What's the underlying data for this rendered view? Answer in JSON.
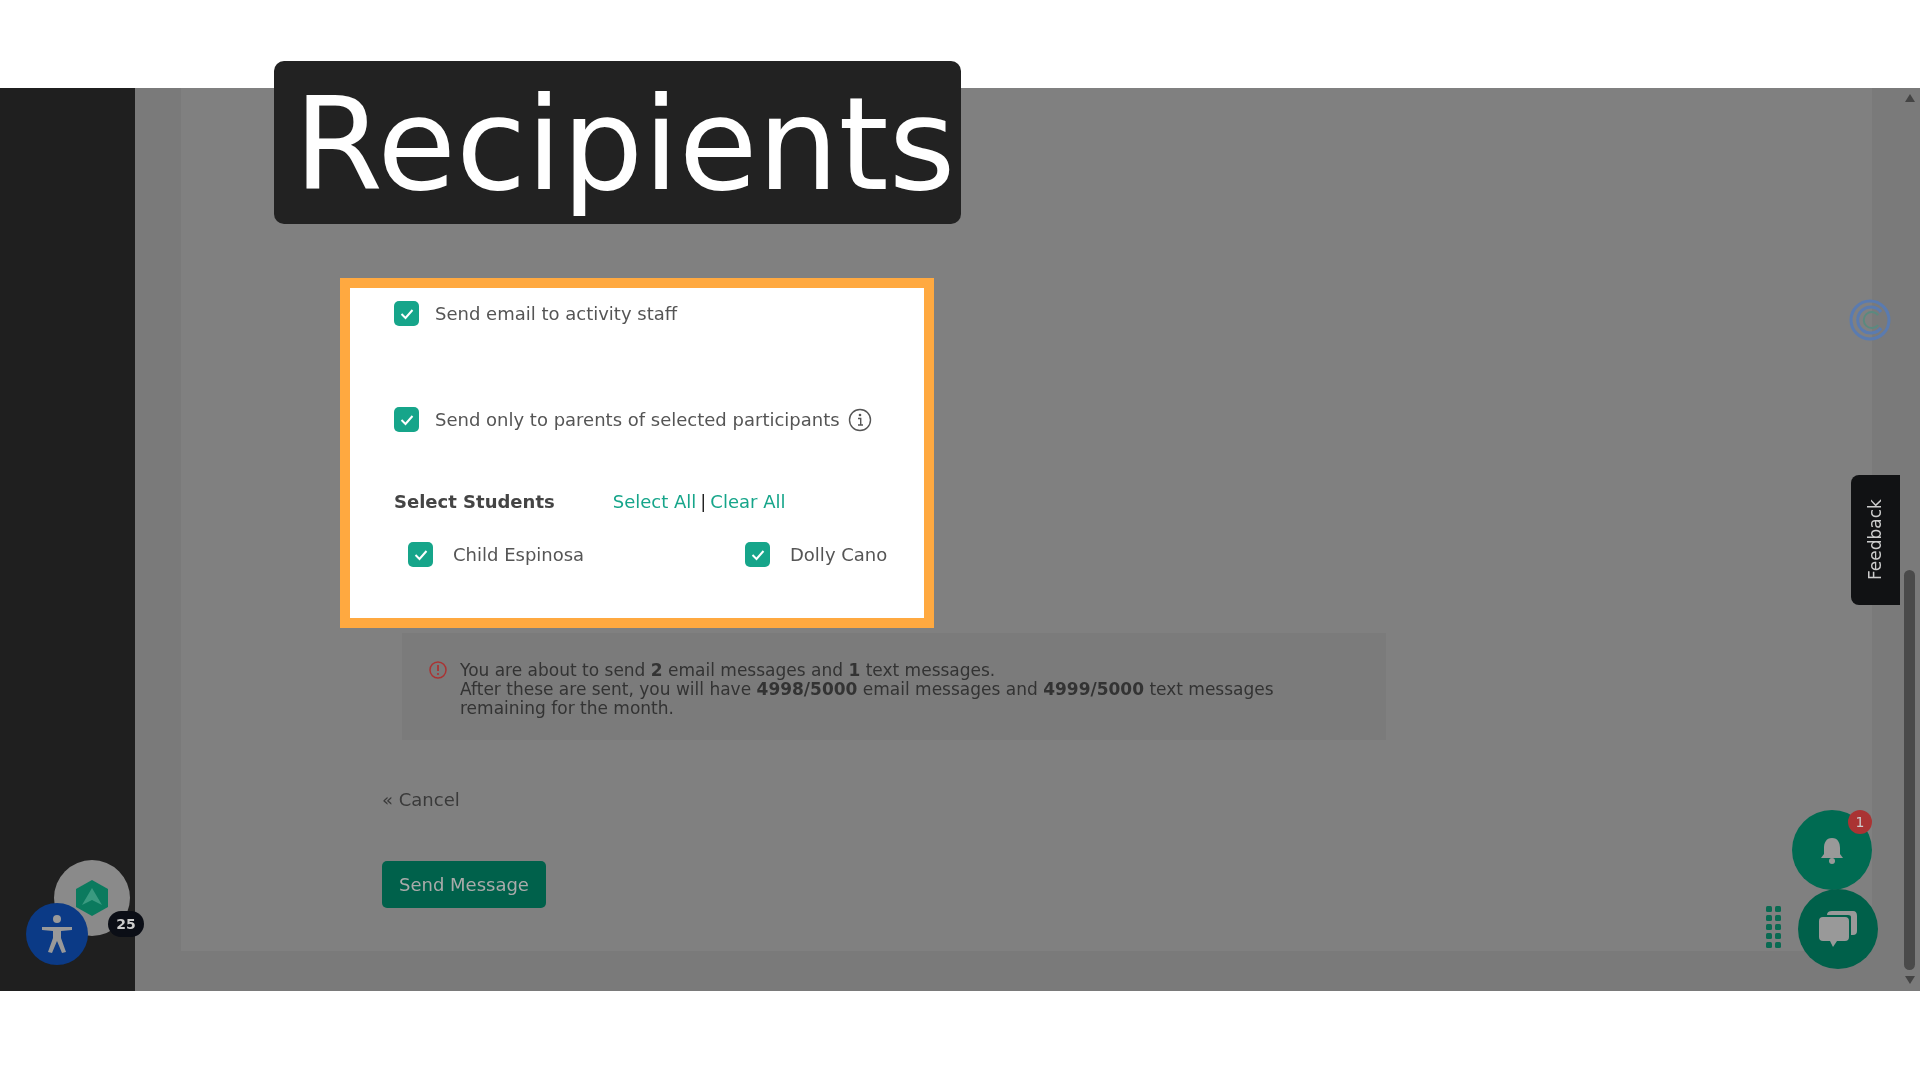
{
  "title_overlay": {
    "text": "Recipients"
  },
  "options": [
    {
      "label": "Send email to activity staff",
      "checked": true,
      "info": false
    },
    {
      "label": "Send only to parents of selected participants",
      "checked": true,
      "info": true
    }
  ],
  "students": {
    "heading": "Select Students",
    "select_all": "Select All",
    "separator": "|",
    "clear_all": "Clear All",
    "items": [
      {
        "name": "Child Espinosa",
        "checked": true
      },
      {
        "name": "Dolly Cano",
        "checked": true
      }
    ]
  },
  "notice": {
    "lines": [
      "You are about to send **2** email messages and **1** text messages.",
      "After these are sent, you will have **4998/5000** email messages and **4999/5000** text messages remaining for the month."
    ]
  },
  "cancel_link": "« Cancel",
  "send_button": "Send Message",
  "feedback_tab": "Feedback",
  "notification_count": "1",
  "widget_badge": "25"
}
